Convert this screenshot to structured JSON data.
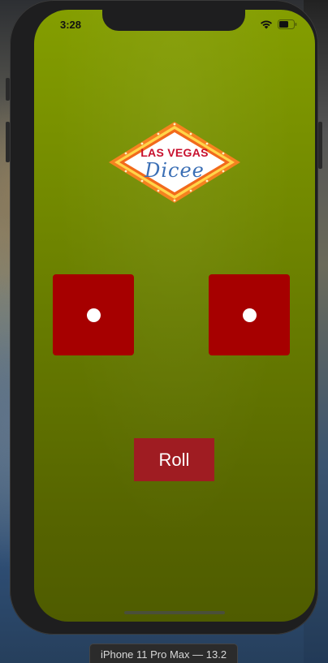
{
  "status_bar": {
    "time": "3:28",
    "icons": [
      "wifi-icon",
      "battery-icon"
    ]
  },
  "logo": {
    "line1": "LAS VEGAS",
    "line2": "Dicee"
  },
  "dice": [
    {
      "name": "left-die",
      "value": 1
    },
    {
      "name": "right-die",
      "value": 1
    }
  ],
  "roll_button": {
    "label": "Roll"
  },
  "device_label": "iPhone 11 Pro Max — 13.2",
  "colors": {
    "background_top": "#849e00",
    "background_bottom": "#4f5c00",
    "die": "#a60000",
    "pip": "#ffffff",
    "button": "#9f1c22",
    "logo_red": "#c8102e",
    "logo_blue": "#3b6fb5",
    "logo_orange": "#f5821f"
  }
}
